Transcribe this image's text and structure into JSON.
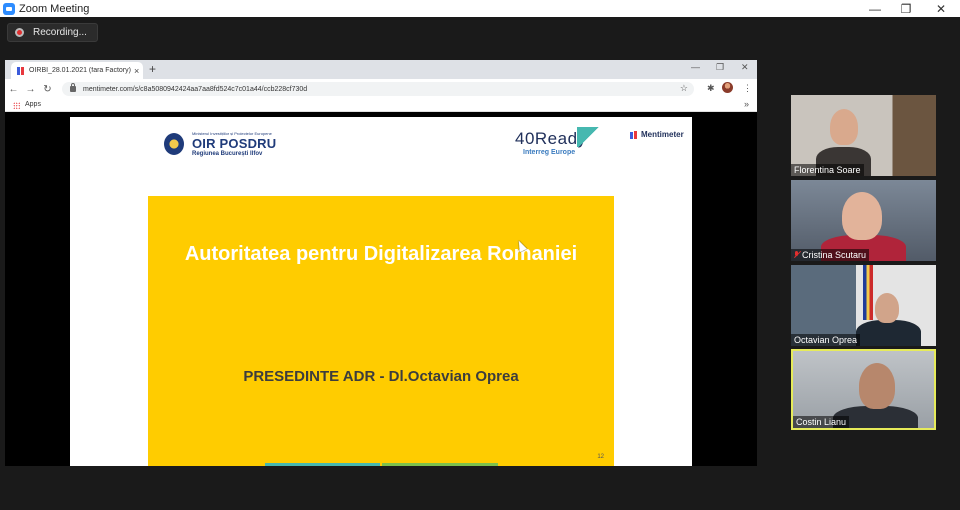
{
  "window": {
    "title": "Zoom Meeting",
    "minimize": "—",
    "maximize": "❐",
    "close": "✕"
  },
  "recording": {
    "label": "Recording..."
  },
  "browser": {
    "tab": {
      "title": "OIRBI_28.01.2021 (fara Factory) -",
      "close": "×"
    },
    "newtab": "+",
    "controls": {
      "minimize": "—",
      "maximize": "❐",
      "close": "✕"
    },
    "nav": {
      "back": "←",
      "forward": "→",
      "reload": "↻"
    },
    "url": "mentimeter.com/s/c8a5080942424aa7aa8fd524c7c01a44/ccb228cf730d",
    "bookmarks": {
      "apps": "Apps",
      "more": "»"
    }
  },
  "slide": {
    "logo_oir": {
      "top": "Ministerul Investițiilor și Proiectelor Europene",
      "main": "OIR POSDRU",
      "sub": "Regiunea București Ilfov"
    },
    "logo_40": {
      "main": "40Ready",
      "sub": "Interreg Europe"
    },
    "logo_menti": "Mentimeter",
    "title": "Autoritatea pentru Digitalizarea Romaniei",
    "subtitle": "PRESEDINTE ADR - Dl.Octavian Oprea",
    "page_number": "12",
    "colors": {
      "yellow": "#ffcc00",
      "accent_teal": "#46b8b0",
      "accent_green": "#7cc04b"
    }
  },
  "participants": [
    {
      "name": "Florentina Soare",
      "muted": false,
      "active": false
    },
    {
      "name": "Cristina Scutaru",
      "muted": true,
      "active": false
    },
    {
      "name": "Octavian Oprea",
      "muted": false,
      "active": false
    },
    {
      "name": "Costin Lianu",
      "muted": false,
      "active": true
    }
  ]
}
